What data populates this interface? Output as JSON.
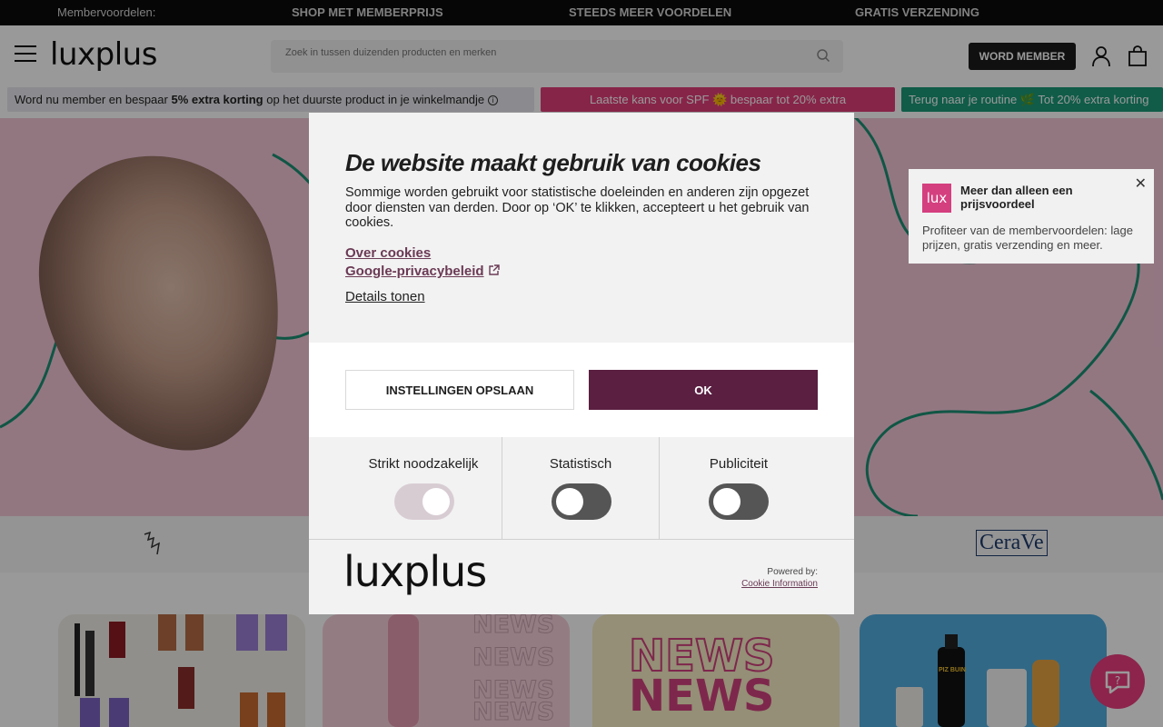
{
  "topbar": {
    "label": "Membervoordelen:",
    "items": [
      "SHOP MET MEMBERPRIJS",
      "STEEDS MEER VOORDELEN",
      "GRATIS VERZENDING"
    ]
  },
  "header": {
    "logo": "luxplus",
    "search_placeholder": "Zoek in tussen duizenden producten en merken",
    "member_button": "WORD MEMBER"
  },
  "strips": {
    "strip1_pre": "Word nu member en bespaar ",
    "strip1_bold": "5% extra korting",
    "strip1_post": " op het duurste product in je winkelmandje",
    "strip2": "Laatste kans voor SPF 🌞 bespaar tot 20% extra",
    "strip3": "Terug naar je routine 🌿 Tot 20% extra korting"
  },
  "brands": {
    "right": "CeraVe"
  },
  "tiles": {
    "news": "NEWS",
    "spray": "PIZ BUIN"
  },
  "toast": {
    "logo": "lux",
    "title": "Meer dan alleen een prijsvoordeel",
    "text": "Profiteer van de membervoordelen: lage prijzen, gratis verzending en meer."
  },
  "cookie": {
    "title": "De website maakt gebruik van cookies",
    "description": "Sommige worden gebruikt voor statistische doeleinden en anderen zijn opgezet door diensten van derden. Door op ‘OK’ te klikken, accepteert u het gebruik van cookies.",
    "link_about": "Over cookies",
    "link_google": "Google-privacybeleid",
    "link_details": "Details tonen",
    "save_button": "INSTELLINGEN OPSLAAN",
    "ok_button": "OK",
    "toggles": [
      {
        "label": "Strikt noodzakelijk",
        "on": true
      },
      {
        "label": "Statistisch",
        "on": false
      },
      {
        "label": "Publiciteit",
        "on": false
      }
    ],
    "footer_logo": "luxplus",
    "powered_by": "Powered by:",
    "powered_link": "Cookie Information"
  },
  "colors": {
    "accent": "#5a1f41",
    "hero": "#f3c6d8",
    "promo_pink": "#e23f7a",
    "promo_green": "#1b9a78"
  }
}
